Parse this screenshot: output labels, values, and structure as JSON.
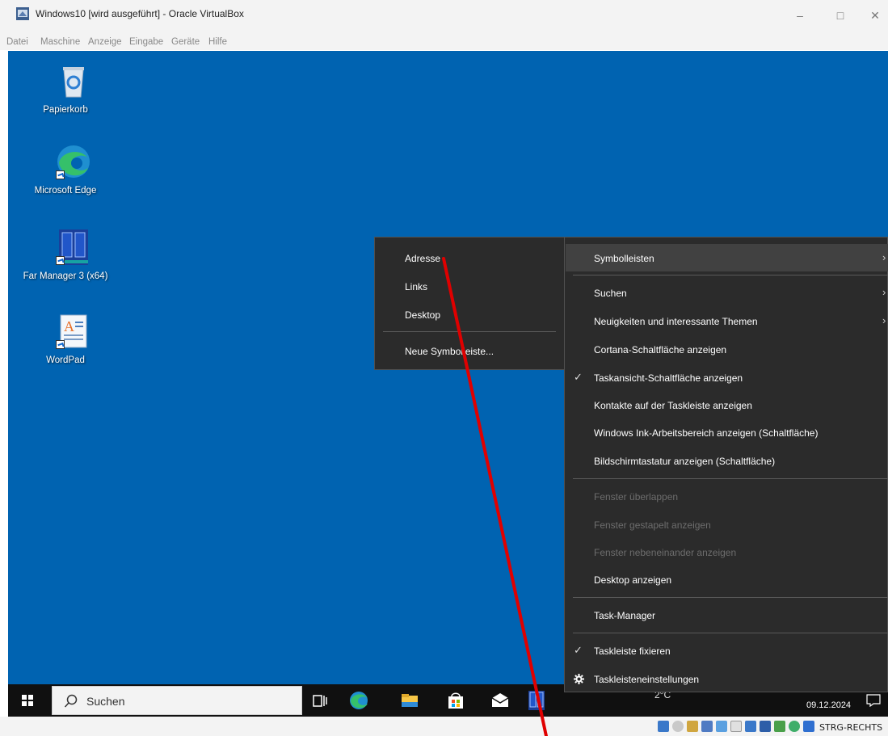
{
  "window": {
    "title": "Windows10 [wird ausgeführt] - Oracle VirtualBox",
    "minimize_glyph": "–",
    "maximize_glyph": "□",
    "close_glyph": "✕"
  },
  "vbox_menu": [
    "Datei",
    "Maschine",
    "Anzeige",
    "Eingabe",
    "Geräte",
    "Hilfe"
  ],
  "desktop_icons": [
    {
      "label": "Papierkorb",
      "icon": "recycle-bin-icon"
    },
    {
      "label": "Microsoft Edge",
      "icon": "edge-icon"
    },
    {
      "label": "Far Manager 3 (x64)",
      "icon": "far-manager-icon"
    },
    {
      "label": "WordPad",
      "icon": "wordpad-icon"
    }
  ],
  "submenu": {
    "items": [
      "Adresse",
      "Links",
      "Desktop"
    ],
    "new_toolbar": "Neue Symbolleiste..."
  },
  "context_menu": {
    "toolbars": "Symbolleisten",
    "search": "Suchen",
    "news": "Neuigkeiten und interessante Themen",
    "cortana": "Cortana-Schaltfläche anzeigen",
    "taskview": "Taskansicht-Schaltfläche anzeigen",
    "contacts": "Kontakte auf der Taskleiste anzeigen",
    "ink": "Windows Ink-Arbeitsbereich anzeigen (Schaltfläche)",
    "keyboard": "Bildschirmtastatur anzeigen (Schaltfläche)",
    "cascade": "Fenster überlappen",
    "stacked": "Fenster gestapelt anzeigen",
    "side_by_side": "Fenster nebeneinander anzeigen",
    "show_desktop": "Desktop anzeigen",
    "task_manager": "Task-Manager",
    "lock_taskbar": "Taskleiste fixieren",
    "taskbar_settings": "Taskleisteneinstellungen",
    "checked": [
      "taskview",
      "lock_taskbar"
    ],
    "disabled": [
      "cascade",
      "stacked",
      "side_by_side"
    ]
  },
  "taskbar": {
    "search_text": "Suchen",
    "temperature": "2°C",
    "date": "09.12.2024"
  },
  "statusbar": {
    "host_key": "STRG-RECHTS"
  },
  "annotation": {
    "color": "#e00000"
  },
  "colors": {
    "desktop": "#0063b1",
    "menu_bg": "#2b2b2b",
    "menu_highlight": "#414141",
    "taskbar": "#101010"
  }
}
